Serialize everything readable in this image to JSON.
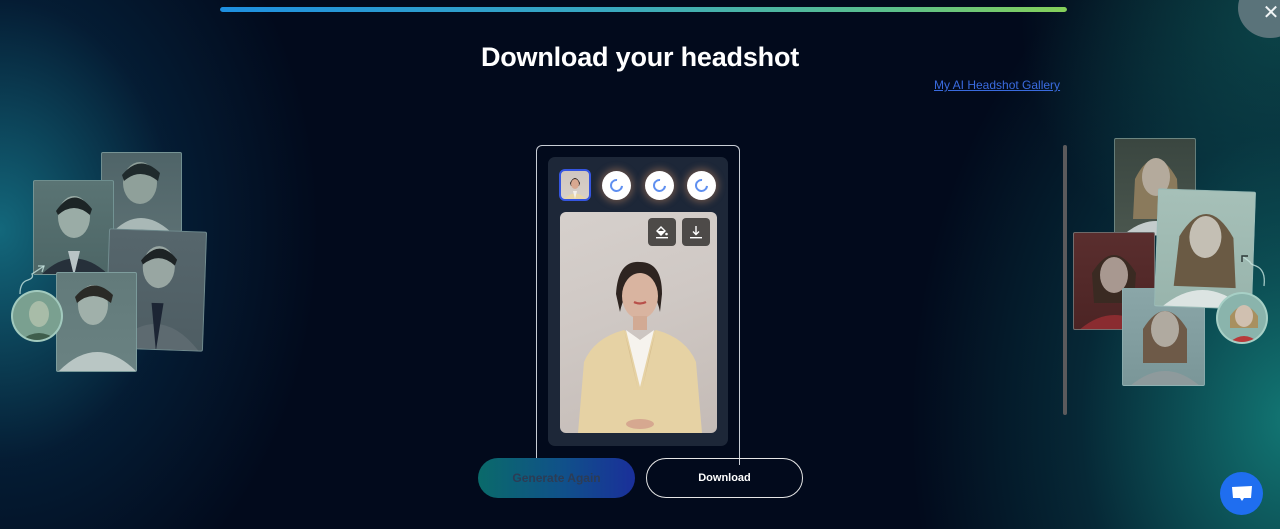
{
  "header": {
    "title": "Download your headshot",
    "gallery_link": "My AI Headshot Gallery",
    "progress_percent": 100
  },
  "colors": {
    "accent_blue": "#1f6ef0",
    "link": "#3a6bdf",
    "progress_start": "#1e8fe0",
    "progress_end": "#86d05a",
    "selected_border": "#3555e0"
  },
  "preview": {
    "thumbnails": [
      {
        "state": "ready",
        "selected": true
      },
      {
        "state": "loading",
        "selected": false
      },
      {
        "state": "loading",
        "selected": false
      },
      {
        "state": "loading",
        "selected": false
      }
    ],
    "tools": [
      {
        "icon": "paint-bucket-icon",
        "label": "Change background"
      },
      {
        "icon": "download-icon",
        "label": "Download image"
      }
    ]
  },
  "actions": {
    "generate_again": "Generate Again",
    "download": "Download"
  },
  "icons": {
    "close": "close-icon",
    "chat": "chat-icon"
  }
}
